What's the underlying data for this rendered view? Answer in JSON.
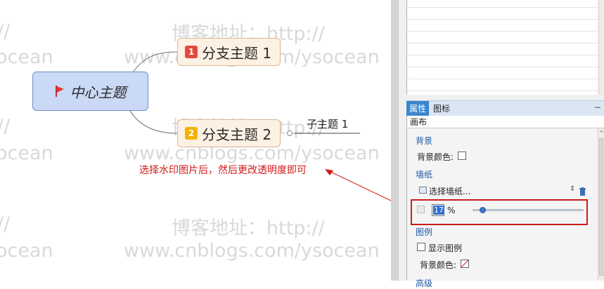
{
  "watermark": {
    "line1": "博客地址：http://",
    "line2": "www.cnblogs.com/ysocean",
    "frag_left_slash": "//",
    "frag_left_ocean": "ocean"
  },
  "mindmap": {
    "central": "中心主题",
    "branches": [
      {
        "badge": "1",
        "label": "分支主题 1",
        "badge_color": "#e24b3b"
      },
      {
        "badge": "2",
        "label": "分支主题 2",
        "badge_color": "#f2b400"
      }
    ],
    "subtopic": "子主题 1"
  },
  "annotation": "选择水印图片后，然后更改透明度即可",
  "panel": {
    "tabs": {
      "active": "属性",
      "inactive": "图标",
      "minimize": "−"
    },
    "breadcrumb": "画布",
    "background": {
      "section": "背景",
      "color_label": "背景颜色:"
    },
    "wallpaper": {
      "section": "墙纸",
      "select_label": "选择墙纸...",
      "opacity_value": "17",
      "opacity_unit": "%",
      "opacity_level": 0.06
    },
    "legend": {
      "section": "图例",
      "show_label": "显示图例",
      "color_label": "背景颜色:"
    },
    "cut_section": "高级"
  },
  "colors": {
    "annotation": "#d01818",
    "tab_active": "#3b86cf",
    "highlight": "#cc1b1b"
  }
}
